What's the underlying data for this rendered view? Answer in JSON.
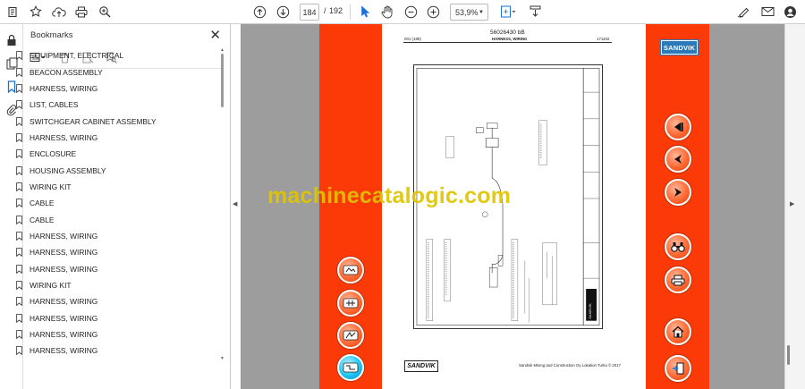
{
  "toolbar": {
    "page_current": "184",
    "page_separator": "/",
    "page_total": "192",
    "zoom": "53,9%"
  },
  "bookmarks": {
    "title": "Bookmarks",
    "items": [
      "EQUIPMENT, ELECTRICAL",
      "BEACON ASSEMBLY",
      "HARNESS, WIRING",
      "LIST, CABLES",
      "SWITCHGEAR CABINET ASSEMBLY",
      "HARNESS, WIRING",
      "ENCLOSURE",
      "HOUSING ASSEMBLY",
      "WIRING KIT",
      "CABLE",
      "CABLE",
      "HARNESS, WIRING",
      "HARNESS, WIRING",
      "HARNESS, WIRING",
      "WIRING KIT",
      "HARNESS, WIRING",
      "HARNESS, WIRING",
      "HARNESS, WIRING",
      "HARNESS, WIRING"
    ]
  },
  "document": {
    "doc_number": "56026430 bB",
    "subtitle": "HARNESS, WIRING",
    "header_left": "001 (189)",
    "header_right": "171102",
    "brand": "SANDVIK",
    "copyright": "Sandvik Mining and Construction Oy Lokation Turku © 2017",
    "side_label": "SANDVIK"
  },
  "watermark": "machinecatalogic.com",
  "colors": {
    "accent_orange": "#fb3a08",
    "brand_blue": "#2b79b8",
    "viewer_gray": "#9d9d9d",
    "watermark_yellow": "#dec400"
  }
}
